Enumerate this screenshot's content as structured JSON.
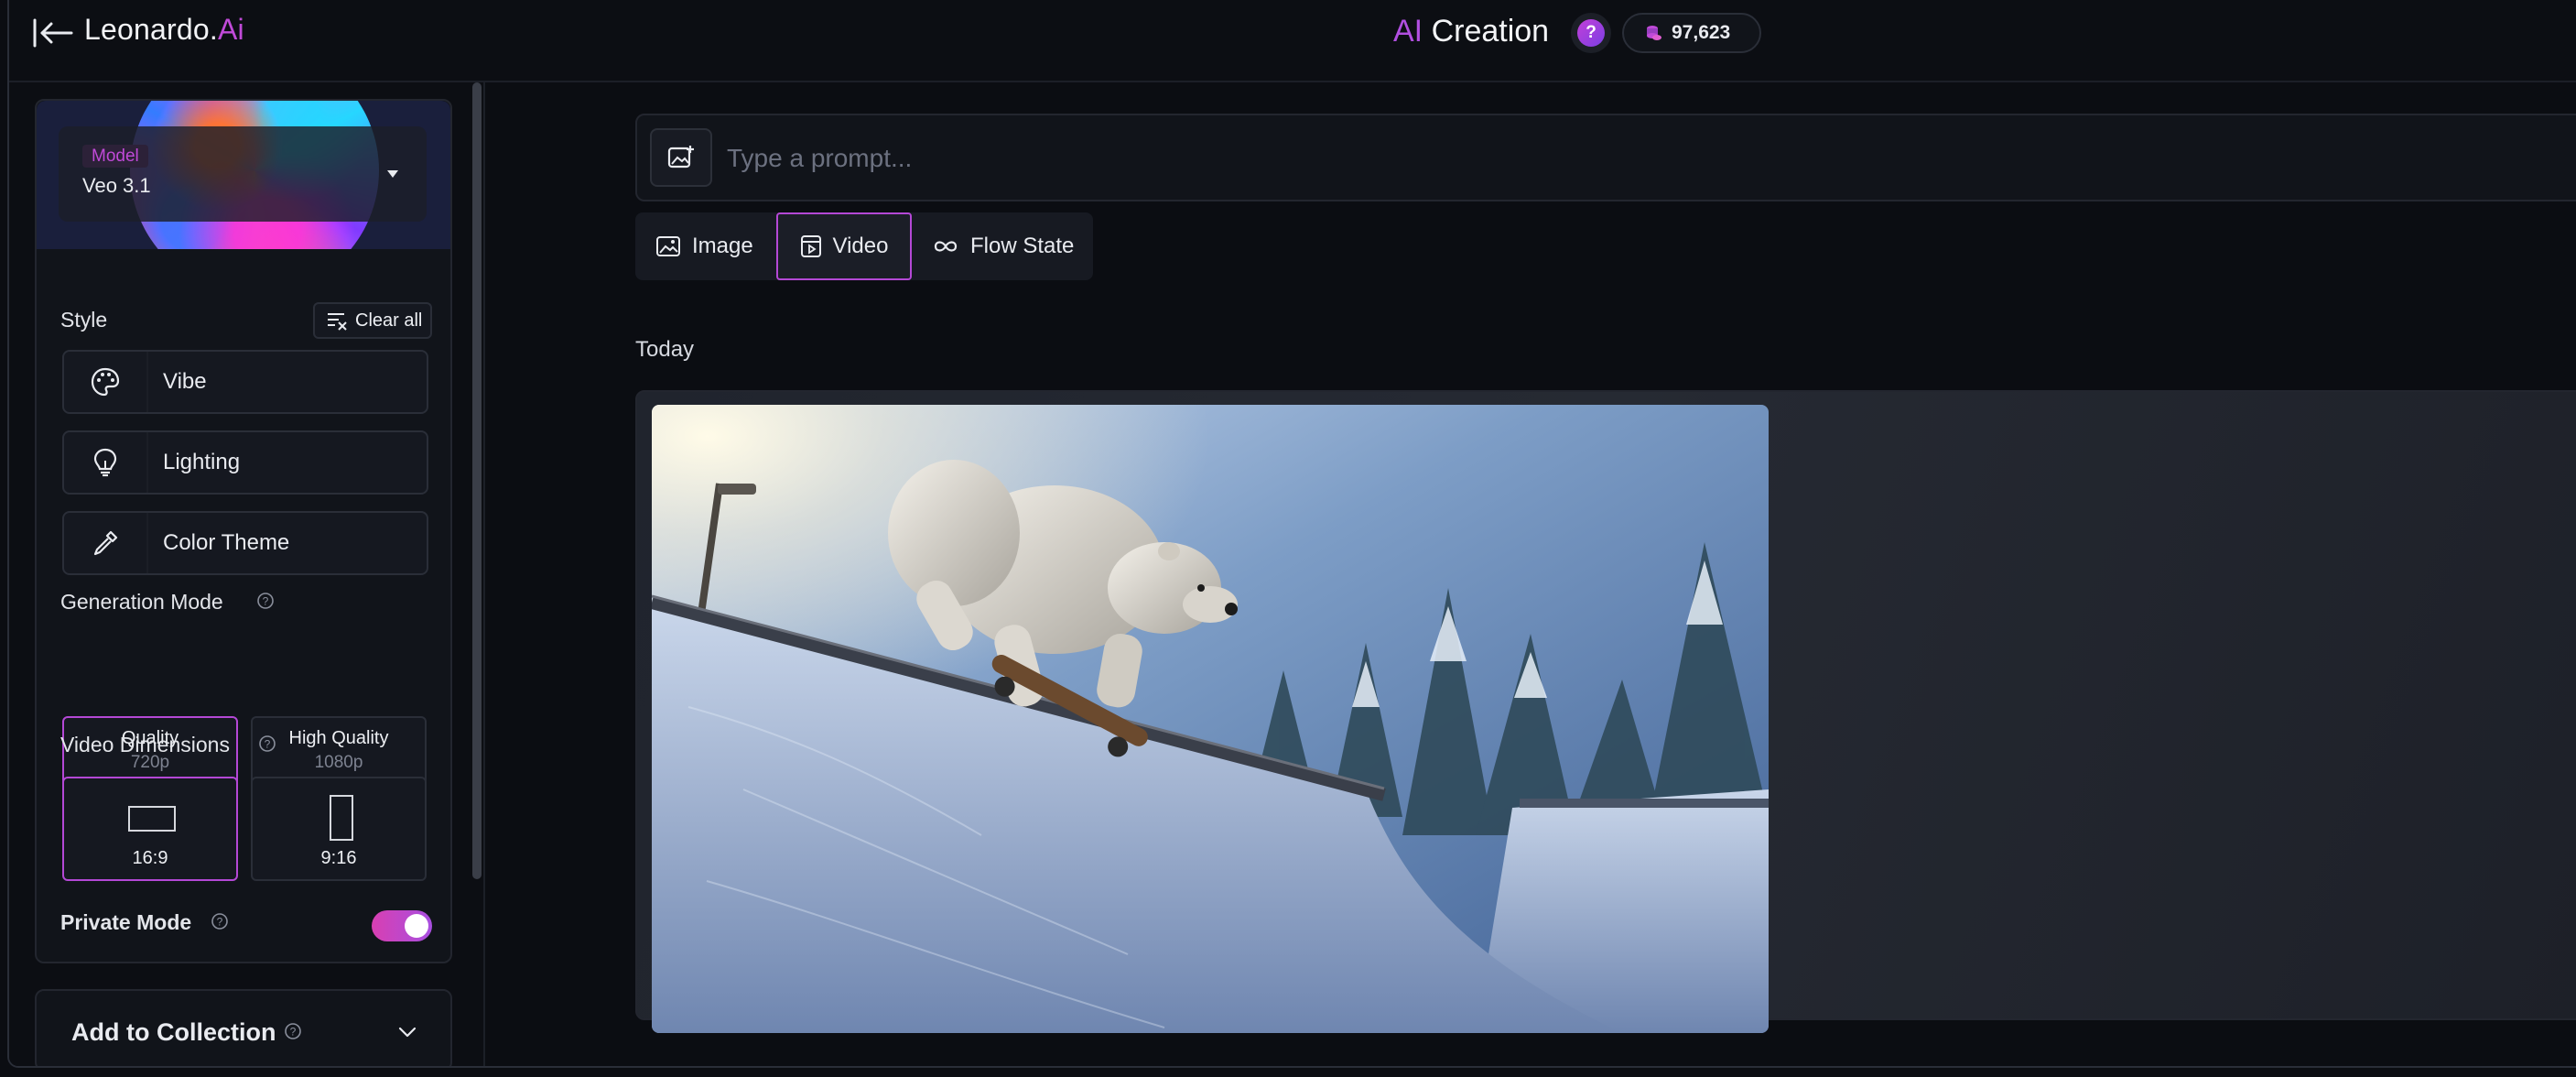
{
  "header": {
    "logo_main": "Leonardo.",
    "logo_accent": "Ai",
    "title_accent": "AI",
    "title_main": " Creation",
    "help_label": "?",
    "token_count": "97,623"
  },
  "sidebar": {
    "model": {
      "tag": "Model",
      "name": "Veo 3.1"
    },
    "style": {
      "heading": "Style",
      "clear_all": "Clear all",
      "buttons": [
        {
          "label": "Vibe",
          "icon": "palette-icon"
        },
        {
          "label": "Lighting",
          "icon": "lightbulb-icon"
        },
        {
          "label": "Color Theme",
          "icon": "eyedropper-icon"
        }
      ]
    },
    "generation_mode": {
      "heading": "Generation Mode",
      "options": [
        {
          "title": "Quality",
          "sub": "720p",
          "active": true
        },
        {
          "title": "High Quality",
          "sub": "1080p",
          "active": false
        }
      ]
    },
    "video_dimensions": {
      "heading": "Video Dimensions",
      "options": [
        {
          "label": "16:9",
          "active": true
        },
        {
          "label": "9:16",
          "active": false
        }
      ]
    },
    "private_mode": {
      "heading": "Private Mode",
      "enabled": true
    },
    "collection": {
      "label": "Add to Collection"
    }
  },
  "main": {
    "prompt_placeholder": "Type a prompt...",
    "tabs": [
      {
        "label": "Image",
        "icon": "image-icon",
        "active": false
      },
      {
        "label": "Video",
        "icon": "video-icon",
        "active": true
      },
      {
        "label": "Flow State",
        "icon": "infinity-icon",
        "active": false
      }
    ],
    "section_today": "Today"
  },
  "colors": {
    "accent": "#b448d6",
    "background": "#0b0d12",
    "panel": "#11141a"
  }
}
